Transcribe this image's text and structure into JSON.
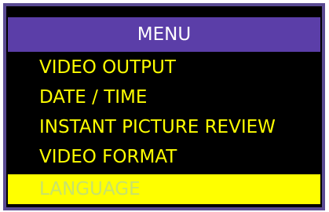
{
  "menu": {
    "title": "MENU",
    "items": [
      {
        "label": "VIDEO OUTPUT",
        "selected": false
      },
      {
        "label": "DATE / TIME",
        "selected": false
      },
      {
        "label": "INSTANT PICTURE REVIEW",
        "selected": false
      },
      {
        "label": "VIDEO FORMAT",
        "selected": false
      },
      {
        "label": "LANGUAGE",
        "selected": true
      }
    ]
  },
  "colors": {
    "frame": "#5a4b93",
    "header_bg": "#5b3ea8",
    "item_text": "#ffff00",
    "selected_bg": "#ffff00",
    "selected_text": "#c8e36b",
    "background": "#000000"
  }
}
